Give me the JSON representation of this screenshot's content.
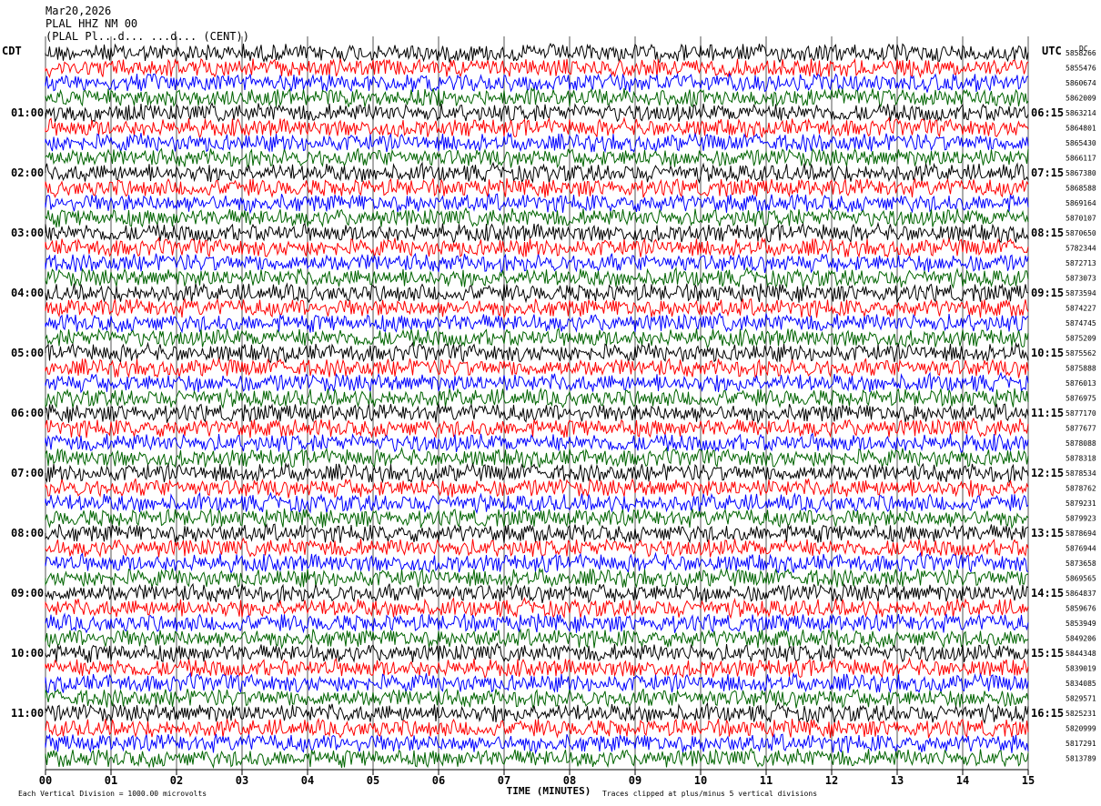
{
  "header": {
    "date": "Mar20,2026",
    "station": "PLAL HHZ NM 00",
    "obscured": "(PLAL Pl...d... ...d... (CENT))"
  },
  "left_timezone": "CDT",
  "right_timezone": "UTC",
  "dc_label": "DC",
  "colors": [
    "#000000",
    "#ff0000",
    "#0000ff",
    "#006400"
  ],
  "chart_data": {
    "type": "seismogram",
    "xlabel": "TIME (MINUTES)",
    "x_ticks": [
      "00",
      "01",
      "02",
      "03",
      "04",
      "05",
      "06",
      "07",
      "08",
      "09",
      "10",
      "11",
      "12",
      "13",
      "14",
      "15"
    ],
    "xlim": [
      0,
      15
    ],
    "left_time_labels": [
      "01:00",
      "02:00",
      "03:00",
      "04:00",
      "05:00",
      "06:00",
      "07:00",
      "08:00",
      "09:00",
      "10:00",
      "11:00"
    ],
    "right_time_labels": [
      "06:15",
      "07:15",
      "08:15",
      "09:15",
      "10:15",
      "11:15",
      "12:15",
      "13:15",
      "14:15",
      "15:15",
      "16:15"
    ],
    "dc_offsets": [
      "5858266",
      "5855476",
      "5860674",
      "5862009",
      "5863214",
      "5864801",
      "5865430",
      "5866117",
      "5867380",
      "5868588",
      "5869164",
      "5870107",
      "5870650",
      "5782344",
      "5872713",
      "5873073",
      "5873594",
      "5874227",
      "5874745",
      "5875209",
      "5875562",
      "5875888",
      "5876013",
      "5876975",
      "5877170",
      "5877677",
      "5878088",
      "5878318",
      "5878534",
      "5878762",
      "5879231",
      "5879923",
      "5878694",
      "5876944",
      "5873658",
      "5869565",
      "5864837",
      "5859676",
      "5853949",
      "5849206",
      "5844348",
      "5839019",
      "5834085",
      "5829571",
      "5825231",
      "5820999",
      "5817291",
      "5813789"
    ]
  },
  "footer": {
    "left": "Each Vertical Division = 1000.00 microvolts",
    "right": "Traces clipped at plus/minus 5 vertical divisions"
  }
}
